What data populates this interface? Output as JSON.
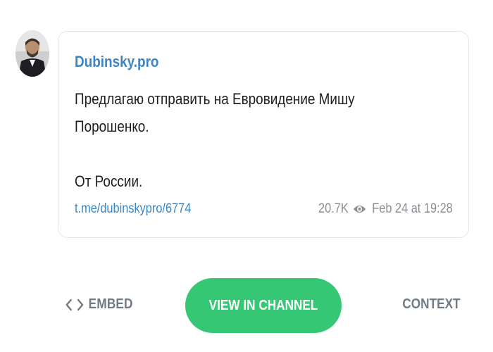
{
  "post": {
    "channel_name": "Dubinsky.pro",
    "text_lines": [
      "Предлагаю отправить на Евровидение Мишу",
      "Порошенко.",
      "",
      "От России."
    ],
    "link": "t.me/dubinskypro/6774",
    "views": "20.7K",
    "views_icon": "eye-icon",
    "date": "Feb 24 at 19:28"
  },
  "actions": {
    "embed_label": "EMBED",
    "embed_icon": "code-brackets-icon",
    "view_channel_label": "VIEW IN CHANNEL",
    "context_label": "CONTEXT"
  },
  "colors": {
    "link": "#3a86c4",
    "button_green": "#36c774",
    "muted": "#8a8f94"
  }
}
